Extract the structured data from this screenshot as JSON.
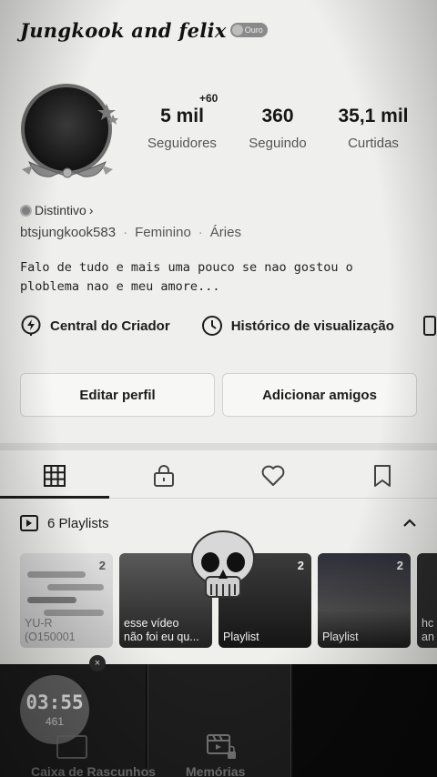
{
  "header": {
    "title": "Jungkook and felix",
    "badge": "Ouro"
  },
  "stats": {
    "followers": {
      "value": "5 mil",
      "label": "Seguidores",
      "delta": "+60"
    },
    "following": {
      "value": "360",
      "label": "Seguindo"
    },
    "likes": {
      "value": "35,1 mil",
      "label": "Curtidas"
    }
  },
  "distintivo": {
    "label": "Distintivo",
    "chevron": "›"
  },
  "meta": {
    "handle": "btsjungkook583",
    "gender": "Feminino",
    "sign": "Áries",
    "separator": "·"
  },
  "bio": {
    "line1": "Falo de tudo e mais uma pouco se nao gostou o",
    "line2": "ploblema nao e meu amore..."
  },
  "creator_row": {
    "creator_center": "Central do Criador",
    "view_history": "Histórico de visualização"
  },
  "buttons": {
    "edit_profile": "Editar perfil",
    "add_friends": "Adicionar amigos"
  },
  "tabs": [
    "grid-icon",
    "lock-icon",
    "heart-icon",
    "bookmark-icon"
  ],
  "playlists": {
    "header": "6 Playlists",
    "cards": [
      {
        "count": "2",
        "caption": "YU-R\n(O150001"
      },
      {
        "count": "",
        "caption": "esse vídeo\nnão foi eu qu..."
      },
      {
        "count": "2",
        "caption": "Playlist"
      },
      {
        "count": "2",
        "caption": "Playlist"
      },
      {
        "count": "",
        "caption": "hc\nan"
      }
    ]
  },
  "bottom": {
    "timer": "03:55",
    "timer_sub": "461",
    "close": "×",
    "drafts_label": "Caixa de Rascunhos",
    "memories_label": "Memórias"
  }
}
